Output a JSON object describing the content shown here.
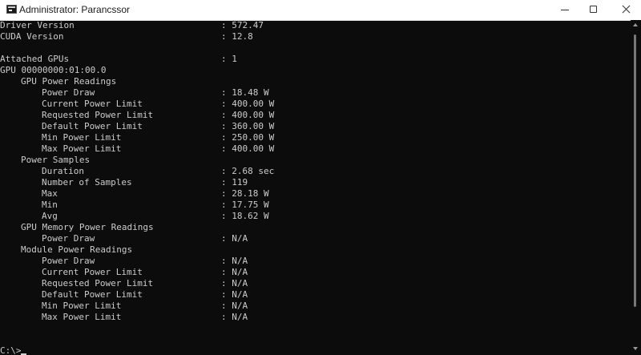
{
  "window": {
    "title": "Administrator: Parancssor",
    "icon": "console-icon",
    "controls": [
      "minimize-icon",
      "maximize-icon",
      "close-icon"
    ]
  },
  "console": {
    "lines": [
      {
        "label": "Driver Version",
        "value": ": 572.47"
      },
      {
        "label": "CUDA Version",
        "value": ": 12.8"
      },
      {
        "label": "Attached GPUs",
        "value": ": 1"
      },
      {
        "label": "GPU 00000000:01:00.0",
        "value": ""
      },
      {
        "label": "GPU Power Readings",
        "value": ""
      },
      {
        "label": "Power Draw",
        "value": ": 18.48 W"
      },
      {
        "label": "Current Power Limit",
        "value": ": 400.00 W"
      },
      {
        "label": "Requested Power Limit",
        "value": ": 400.00 W"
      },
      {
        "label": "Default Power Limit",
        "value": ": 360.00 W"
      },
      {
        "label": "Min Power Limit",
        "value": ": 250.00 W"
      },
      {
        "label": "Max Power Limit",
        "value": ": 400.00 W"
      },
      {
        "label": "Power Samples",
        "value": ""
      },
      {
        "label": "Duration",
        "value": ": 2.68 sec"
      },
      {
        "label": "Number of Samples",
        "value": ": 119"
      },
      {
        "label": "Max",
        "value": ": 28.18 W"
      },
      {
        "label": "Min",
        "value": ": 17.75 W"
      },
      {
        "label": "Avg",
        "value": ": 18.62 W"
      },
      {
        "label": "GPU Memory Power Readings",
        "value": ""
      },
      {
        "label": "Power Draw",
        "value": ": N/A"
      },
      {
        "label": "Module Power Readings",
        "value": ""
      },
      {
        "label": "Power Draw",
        "value": ": N/A"
      },
      {
        "label": "Current Power Limit",
        "value": ": N/A"
      },
      {
        "label": "Requested Power Limit",
        "value": ": N/A"
      },
      {
        "label": "Default Power Limit",
        "value": ": N/A"
      },
      {
        "label": "Min Power Limit",
        "value": ": N/A"
      },
      {
        "label": "Max Power Limit",
        "value": ": N/A"
      }
    ],
    "prompt": "C:\\>"
  },
  "colors": {
    "background": "#0c0c0c",
    "text": "#cccccc",
    "titlebar": "#ffffff"
  }
}
